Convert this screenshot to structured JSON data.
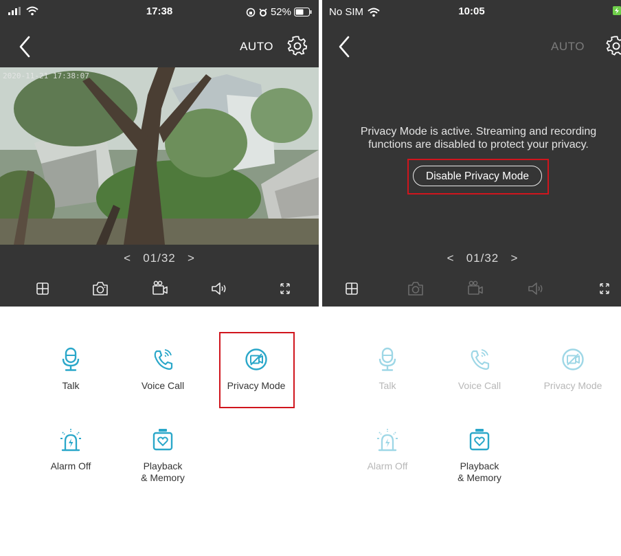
{
  "left_screen": {
    "status": {
      "time": "17:38",
      "battery": "52%"
    },
    "nav": {
      "mode": "AUTO"
    },
    "video": {
      "timestamp": "2020-11-21 17:38:07"
    },
    "pager": {
      "prev": "<",
      "page": "01/32",
      "next": ">"
    },
    "features": [
      {
        "label": "Talk",
        "icon": "microphone-icon"
      },
      {
        "label": "Voice Call",
        "icon": "phone-call-icon"
      },
      {
        "label": "Privacy Mode",
        "icon": "camera-off-icon"
      },
      {
        "label": "Alarm Off",
        "icon": "alarm-siren-icon"
      },
      {
        "label": "Playback\n& Memory",
        "icon": "sd-card-icon"
      }
    ]
  },
  "right_screen": {
    "status": {
      "carrier": "No SIM",
      "time": "10:05"
    },
    "nav": {
      "mode": "AUTO"
    },
    "privacy": {
      "message": "Privacy Mode is active. Streaming and recording functions are disabled to protect your privacy.",
      "button": "Disable Privacy Mode"
    },
    "pager": {
      "prev": "<",
      "page": "01/32",
      "next": ">"
    },
    "features": [
      {
        "label": "Talk",
        "icon": "microphone-icon"
      },
      {
        "label": "Voice Call",
        "icon": "phone-call-icon"
      },
      {
        "label": "Privacy Mode",
        "icon": "camera-off-icon"
      },
      {
        "label": "Alarm Off",
        "icon": "alarm-siren-icon"
      },
      {
        "label": "Playback\n& Memory",
        "icon": "sd-card-icon"
      }
    ]
  },
  "colors": {
    "dark_panel": "#353535",
    "accent": "#2aa7c9",
    "highlight": "#d0151d"
  }
}
